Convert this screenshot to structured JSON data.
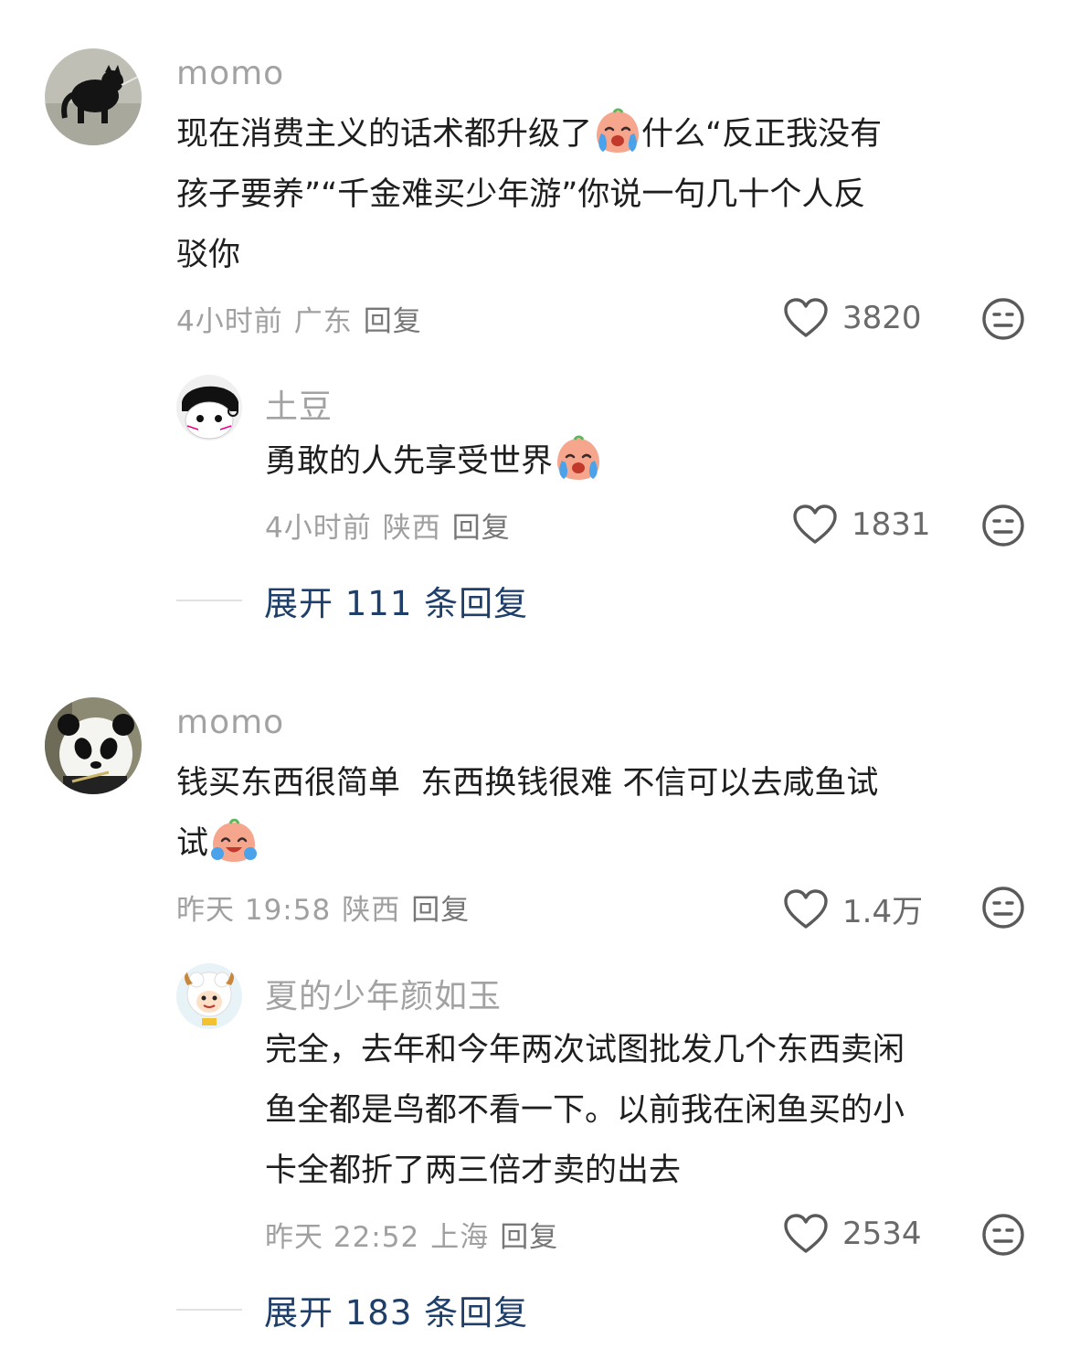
{
  "comments": [
    {
      "username": "momo",
      "text_before_emoji": "现在消费主义的话术都升级了",
      "emoji": "cry-laugh-emoji",
      "text_lines_after": [
        "什么“反正我没有",
        "孩子要养”“千金难买少年游”你说一句几十个人反",
        "驳你"
      ],
      "time": "4小时前",
      "location": "广东",
      "reply_label": "回复",
      "likes": "3820",
      "reply": {
        "username": "土豆",
        "text": "勇敢的人先享受世界",
        "emoji": "cry-laugh-emoji",
        "time": "4小时前",
        "location": "陕西",
        "reply_label": "回复",
        "likes": "1831"
      },
      "expand_label": "展开 111 条回复"
    },
    {
      "username": "momo",
      "text_line1": "钱买东西很简单  东西换钱很难 不信可以去咸鱼试",
      "text_line2": "试",
      "emoji": "laugh-tears-emoji",
      "time": "昨天 19:58",
      "location": "陕西",
      "reply_label": "回复",
      "likes": "1.4万",
      "reply": {
        "username": "夏的少年颜如玉",
        "text_lines": [
          "完全，去年和今年两次试图批发几个东西卖闲",
          "鱼全都是鸟都不看一下。以前我在闲鱼买的小",
          "卡全都折了两三倍才卖的出去"
        ],
        "time": "昨天 22:52",
        "location": "上海",
        "reply_label": "回复",
        "likes": "2534"
      },
      "expand_label": "展开 183 条回复"
    }
  ],
  "icons": {
    "like": "heart-outline-icon",
    "dislike": "meh-face-icon"
  },
  "colors": {
    "username": "#a2a2a2",
    "meta": "#a0a0a0",
    "expand": "#1f3f6b"
  }
}
